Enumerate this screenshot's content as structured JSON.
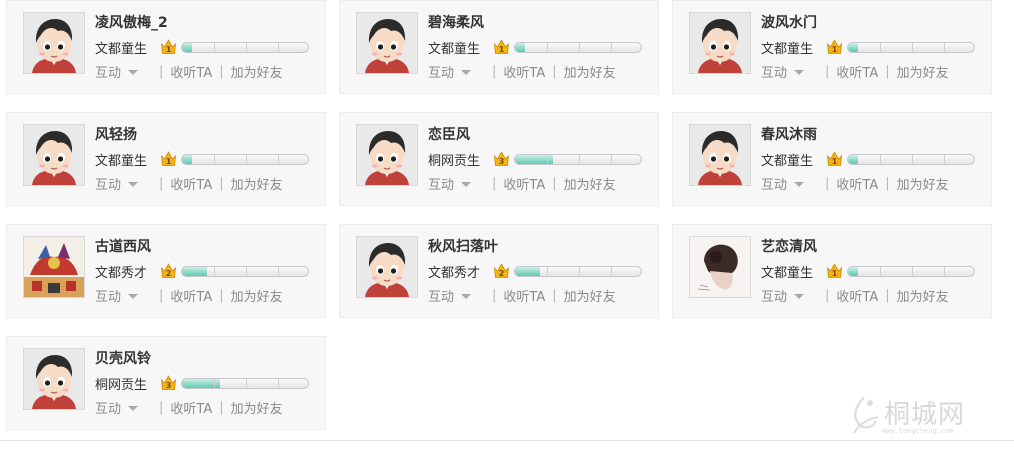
{
  "users": [
    {
      "name": "凌风傲梅_2",
      "rank": "文都童生",
      "level": "1",
      "progress": 0.08,
      "avatar": "default-boy-avatar"
    },
    {
      "name": "碧海柔风",
      "rank": "文都童生",
      "level": "1",
      "progress": 0.08,
      "avatar": "default-boy-avatar"
    },
    {
      "name": "波风水门",
      "rank": "文都童生",
      "level": "1",
      "progress": 0.08,
      "avatar": "default-boy-avatar"
    },
    {
      "name": "风轻扬",
      "rank": "文都童生",
      "level": "1",
      "progress": 0.08,
      "avatar": "default-boy-avatar"
    },
    {
      "name": "恋臣风",
      "rank": "桐网贡生",
      "level": "3",
      "progress": 0.3,
      "avatar": "default-boy-avatar"
    },
    {
      "name": "春风沐雨",
      "rank": "文都童生",
      "level": "1",
      "progress": 0.08,
      "avatar": "default-boy-avatar"
    },
    {
      "name": "古道西风",
      "rank": "文都秀才",
      "level": "2",
      "progress": 0.2,
      "avatar": "festival-photo-avatar"
    },
    {
      "name": "秋风扫落叶",
      "rank": "文都秀才",
      "level": "2",
      "progress": 0.2,
      "avatar": "default-boy-avatar"
    },
    {
      "name": "艺恋清风",
      "rank": "文都童生",
      "level": "1",
      "progress": 0.08,
      "avatar": "hair-bun-photo-avatar"
    },
    {
      "name": "贝壳风铃",
      "rank": "桐网贡生",
      "level": "3",
      "progress": 0.3,
      "avatar": "default-boy-avatar"
    }
  ],
  "actions": {
    "interact": "互动",
    "follow": "收听TA",
    "add_friend": "加为好友",
    "separator": "|"
  },
  "watermark": {
    "text": "桐城网",
    "url": "www.tongcheng.com"
  },
  "colors": {
    "progress_fill": "#5fc9ad",
    "level_badge": "#f2b416",
    "card_bg": "#f7f7f7",
    "text": "#333333",
    "muted": "#8a8a8a"
  }
}
